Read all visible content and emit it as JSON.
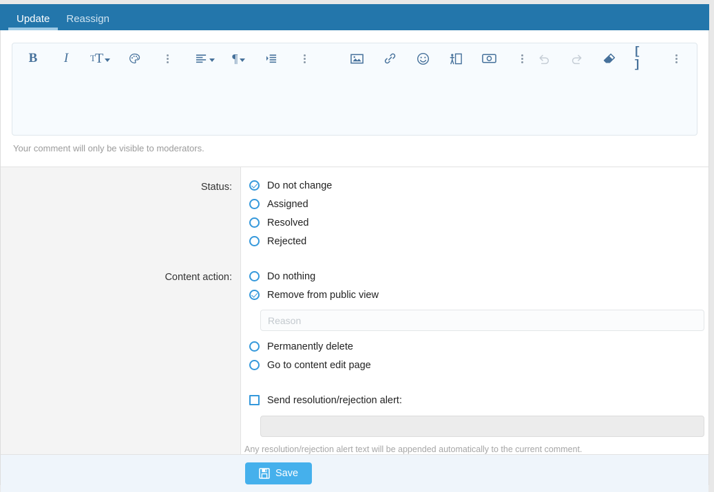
{
  "tabs": [
    {
      "label": "Update",
      "active": true
    },
    {
      "label": "Reassign",
      "active": false
    }
  ],
  "editor": {
    "content": "",
    "hint": "Your comment will only be visible to moderators.",
    "toolbar": {
      "bold": "B",
      "italic": "I",
      "font_size": "T",
      "text_color_icon": "palette-icon",
      "more_text_icon": "kebab-menu-icon",
      "align_icon": "align-left-icon",
      "paragraph": "¶",
      "indent_icon": "indent-icon",
      "more_paragraph_icon": "kebab-menu-icon",
      "image_icon": "image-icon",
      "link_icon": "link-icon",
      "emoji_icon": "smiley-icon",
      "insert_template_icon": "insert-template-icon",
      "media_icon": "media-embed-icon",
      "more_insert_icon": "kebab-menu-icon",
      "undo_icon": "undo-icon",
      "redo_icon": "redo-icon",
      "clear_format_icon": "eraser-icon",
      "source_code": "[ ]",
      "more_tools_icon": "kebab-menu-icon"
    }
  },
  "form": {
    "status": {
      "label": "Status:",
      "options": [
        {
          "label": "Do not change",
          "checked": true
        },
        {
          "label": "Assigned",
          "checked": false
        },
        {
          "label": "Resolved",
          "checked": false
        },
        {
          "label": "Rejected",
          "checked": false
        }
      ]
    },
    "content_action": {
      "label": "Content action:",
      "options": [
        {
          "label": "Do nothing",
          "checked": false
        },
        {
          "label": "Remove from public view",
          "checked": true
        },
        {
          "label": "Permanently delete",
          "checked": false
        },
        {
          "label": "Go to content edit page",
          "checked": false
        }
      ],
      "reason_placeholder": "Reason",
      "reason_value": ""
    },
    "alert": {
      "label": "Send resolution/rejection alert:",
      "checked": false,
      "text_value": "",
      "text_placeholder": "",
      "note": "Any resolution/rejection alert text will be appended automatically to the current comment."
    }
  },
  "footer": {
    "save_label": "Save",
    "save_icon": "floppy-disk-icon"
  },
  "colors": {
    "tabbar": "#2376ab",
    "accent": "#3498db",
    "save_button": "#45b0ec",
    "label_column": "#f4f4f4",
    "footer": "#eff5fb"
  }
}
